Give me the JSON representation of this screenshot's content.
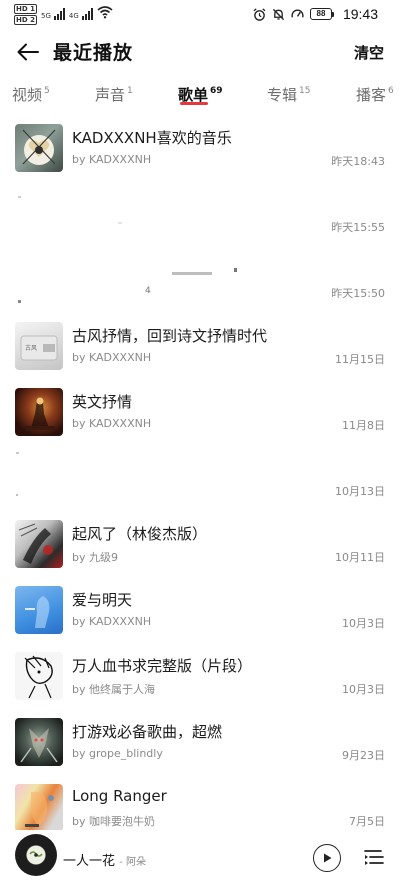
{
  "status_bar": {
    "hd_top": "HD 1",
    "hd_bottom": "HD 2",
    "net1": "5G",
    "net2": "4G",
    "battery": "88",
    "time": "19:43"
  },
  "header": {
    "title": "最近播放",
    "clear_label": "清空"
  },
  "tabs": [
    {
      "label": "视频",
      "count": "5"
    },
    {
      "label": "声音",
      "count": "1"
    },
    {
      "label": "歌单",
      "count": "69",
      "active": true
    },
    {
      "label": "专辑",
      "count": "15"
    },
    {
      "label": "播客",
      "count": "6"
    }
  ],
  "playlists": [
    {
      "title": "KADXXXNH喜欢的音乐",
      "by": "by KADXXXNH",
      "time": "昨天18:43"
    },
    {
      "title": "",
      "by": "",
      "time": "昨天15:55"
    },
    {
      "title": "",
      "by": "",
      "time": "昨天15:50"
    },
    {
      "title": "古风抒情，回到诗文抒情时代",
      "by": "by KADXXXNH",
      "time": "11月15日"
    },
    {
      "title": "英文抒情",
      "by": "by KADXXXNH",
      "time": "11月8日"
    },
    {
      "title": "",
      "by": "",
      "time": "10月13日"
    },
    {
      "title": "起风了（林俊杰版）",
      "by": "by 九级9",
      "time": "10月11日"
    },
    {
      "title": "爱与明天",
      "by": "by KADXXXNH",
      "time": "10月3日"
    },
    {
      "title": "万人血书求完整版（片段）",
      "by": "by 他终属于人海",
      "time": "10月3日"
    },
    {
      "title": "打游戏必备歌曲，超燃",
      "by": "by grope_blindly",
      "time": "9月23日"
    },
    {
      "title": "Long Ranger",
      "by": "by 咖啡要泡牛奶",
      "time": "7月5日"
    }
  ],
  "faint_char": "4",
  "player": {
    "song": "一人一花",
    "artist": "- 阿朵"
  },
  "colors": {
    "accent_red": "#e8383d",
    "text_primary": "#1c1c1c",
    "text_secondary": "#8a8a8a"
  }
}
